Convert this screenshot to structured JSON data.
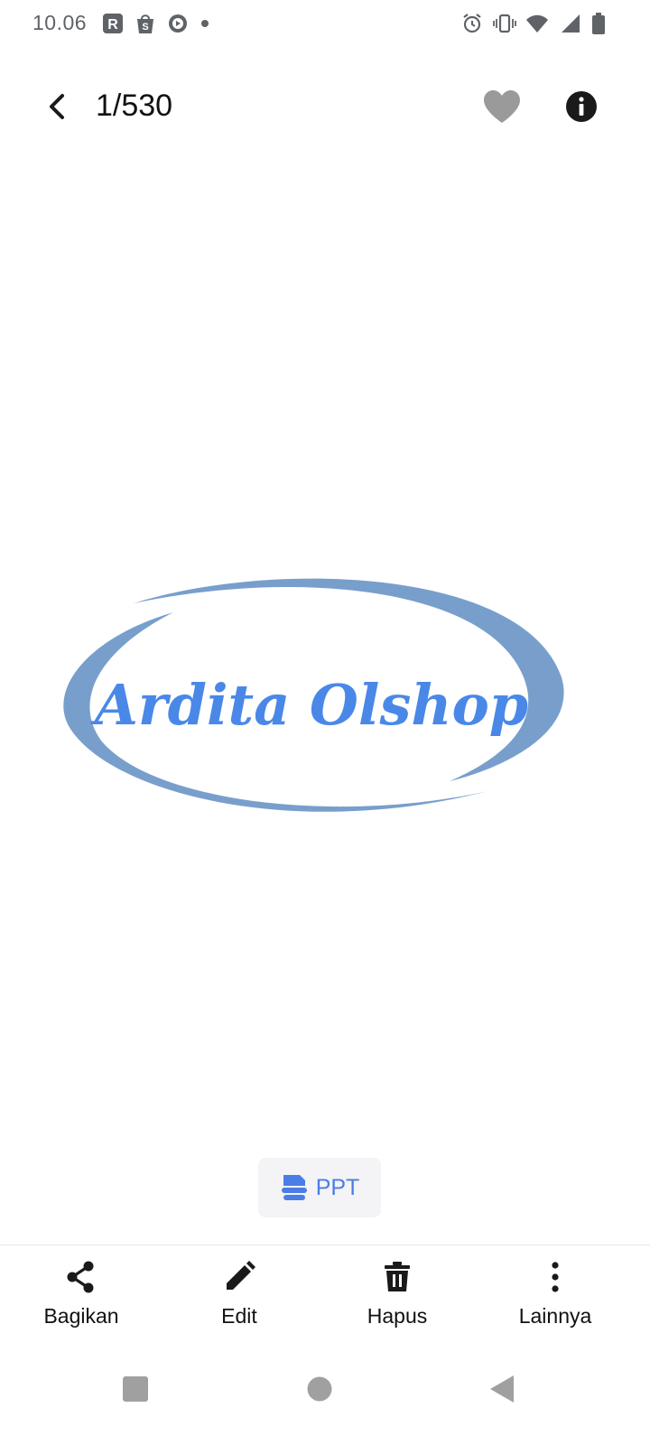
{
  "status_bar": {
    "time": "10.06",
    "left_icons": [
      "r-app-icon",
      "shopee-bag-icon",
      "media-app-icon",
      "dot-icon"
    ],
    "right_icons": [
      "alarm-icon",
      "vibrate-icon",
      "wifi-icon",
      "cell-signal-icon",
      "battery-icon"
    ]
  },
  "top_bar": {
    "counter": "1/530",
    "back_icon": "arrow-left-icon",
    "favorite_icon": "heart-icon",
    "info_icon": "info-icon"
  },
  "photo": {
    "logo_text": "Ardita Olshop",
    "text_color": "#4a88e8",
    "ring_color": "#789fcc"
  },
  "chip": {
    "label": "PPT",
    "icon": "ppt-doc-icon",
    "color": "#4a7de8"
  },
  "actions": [
    {
      "label": "Bagikan",
      "icon": "share-icon"
    },
    {
      "label": "Edit",
      "icon": "pencil-icon"
    },
    {
      "label": "Hapus",
      "icon": "trash-icon"
    },
    {
      "label": "Lainnya",
      "icon": "more-vert-icon"
    }
  ],
  "nav": {
    "recents_icon": "square-icon",
    "home_icon": "circle-icon",
    "back_icon": "triangle-back-icon"
  },
  "colors": {
    "icon_dark": "#1a1a1a",
    "icon_gray": "#9a9a9a",
    "status_gray": "#5f6368",
    "nav_gray": "#a0a0a0"
  }
}
